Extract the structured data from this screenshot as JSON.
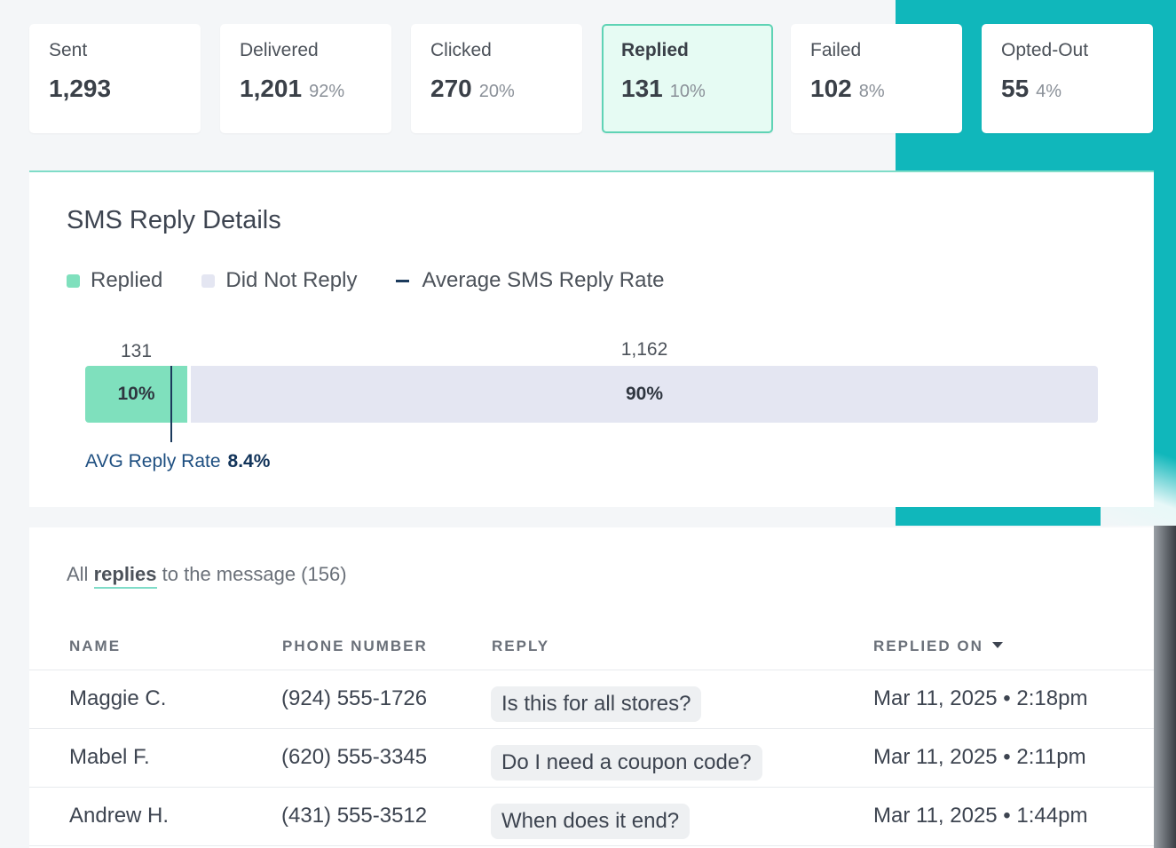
{
  "stats": [
    {
      "label": "Sent",
      "value": "1,293",
      "pct": ""
    },
    {
      "label": "Delivered",
      "value": "1,201",
      "pct": "92%"
    },
    {
      "label": "Clicked",
      "value": "270",
      "pct": "20%"
    },
    {
      "label": "Replied",
      "value": "131",
      "pct": "10%",
      "active": true
    },
    {
      "label": "Failed",
      "value": "102",
      "pct": "8%"
    },
    {
      "label": "Opted-Out",
      "value": "55",
      "pct": "4%"
    }
  ],
  "details": {
    "title": "SMS Reply Details",
    "legend": {
      "replied": "Replied",
      "not_replied": "Did Not Reply",
      "avg": "Average SMS Reply Rate"
    },
    "bar": {
      "replied_count": "131",
      "replied_pct": "10%",
      "not_replied_count": "1,162",
      "not_replied_pct": "90%",
      "replied_fraction": 0.101,
      "avg_fraction": 0.084
    },
    "avg_label": "AVG Reply Rate",
    "avg_value": "8.4%"
  },
  "colors": {
    "replied": "#7fe0bd",
    "not_replied": "#e4e6f2",
    "avg_line": "#1b3a5c",
    "teal": "#10b7bb"
  },
  "replies": {
    "title_pre": "All",
    "title_link": "replies",
    "title_post": "to the message (156)",
    "columns": {
      "name": "NAME",
      "phone": "PHONE NUMBER",
      "reply": "REPLY",
      "replied_on": "REPLIED ON"
    },
    "sort_icon": "caret-down-icon",
    "rows": [
      {
        "name": "Maggie C.",
        "phone": "(924) 555-1726",
        "reply": "Is this for all stores?",
        "date": "Mar 11, 2025 • 2:18pm"
      },
      {
        "name": "Mabel F.",
        "phone": "(620) 555-3345",
        "reply": "Do I need a coupon code?",
        "date": "Mar 11, 2025 • 2:11pm"
      },
      {
        "name": "Andrew H.",
        "phone": "(431) 555-3512",
        "reply": "When does it end?",
        "date": "Mar 11, 2025 • 1:44pm"
      }
    ]
  }
}
